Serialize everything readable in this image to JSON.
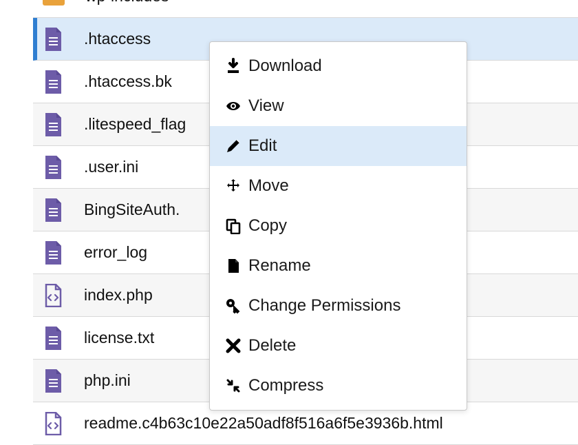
{
  "files": [
    {
      "name": "wp-includes",
      "type": "folder"
    },
    {
      "name": ".htaccess",
      "type": "doc",
      "selected": true
    },
    {
      "name": ".htaccess.bk",
      "type": "doc"
    },
    {
      "name": ".litespeed_flag",
      "type": "doc"
    },
    {
      "name": ".user.ini",
      "type": "doc"
    },
    {
      "name": "BingSiteAuth.",
      "type": "doc"
    },
    {
      "name": "error_log",
      "type": "doc"
    },
    {
      "name": "index.php",
      "type": "code"
    },
    {
      "name": "license.txt",
      "type": "doc"
    },
    {
      "name": "php.ini",
      "type": "doc"
    },
    {
      "name": "readme.c4b63c10e22a50adf8f516a6f5e3936b.html",
      "type": "code"
    }
  ],
  "menu": {
    "download": "Download",
    "view": "View",
    "edit": "Edit",
    "move": "Move",
    "copy": "Copy",
    "rename": "Rename",
    "permissions": "Change Permissions",
    "delete": "Delete",
    "compress": "Compress"
  },
  "colors": {
    "selected_bg": "#dbeaf9",
    "selected_border": "#2f7ed1",
    "doc_icon": "#6d5ca8",
    "folder_icon": "#e9a23b"
  }
}
